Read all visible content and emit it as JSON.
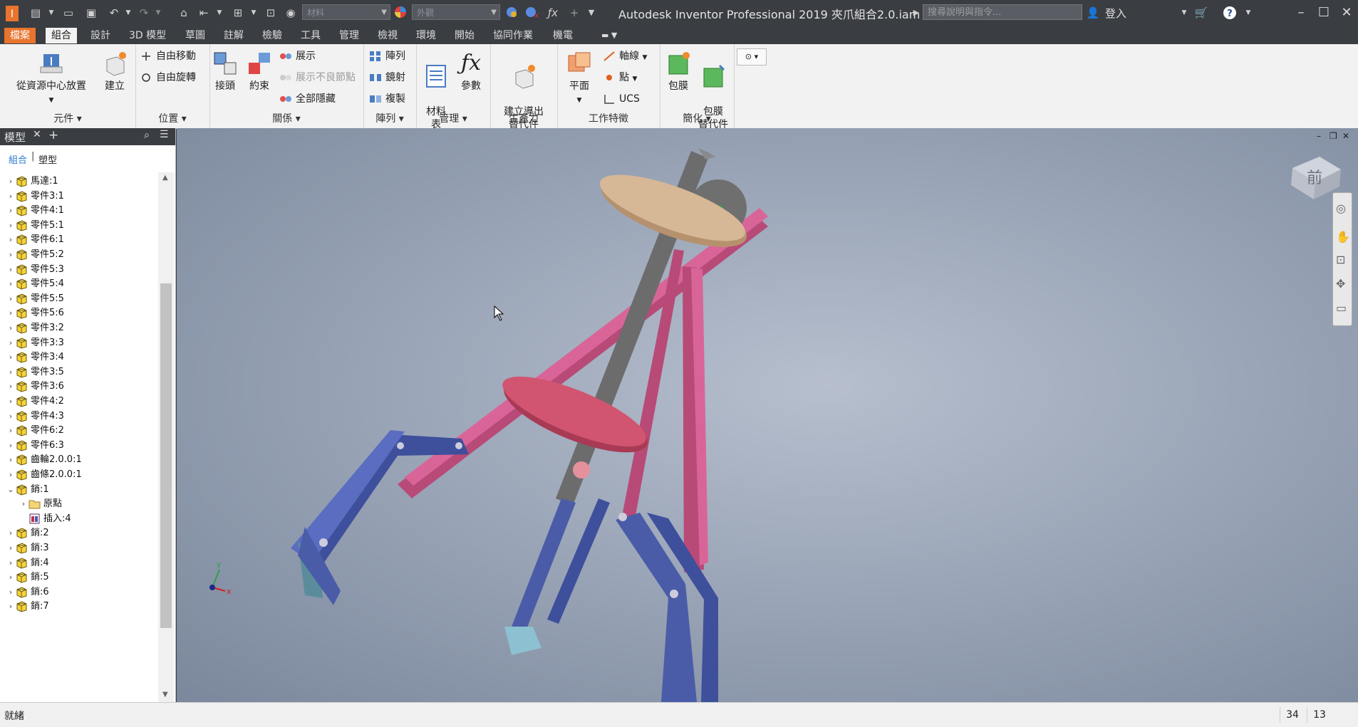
{
  "titlebar": {
    "app_title": "Autodesk Inventor Professional 2019    夾爪組合2.0.iam",
    "material_combo": "材料",
    "appearance_combo": "外觀",
    "search_placeholder": "搜尋說明與指令...",
    "signin": "登入"
  },
  "tabs": [
    "檔案",
    "組合",
    "設計",
    "3D 模型",
    "草圖",
    "註解",
    "檢驗",
    "工具",
    "管理",
    "檢視",
    "環境",
    "開始",
    "協同作業",
    "機電"
  ],
  "ribbon": {
    "component": {
      "place_from_cc": "從資源中心放置",
      "create": "建立",
      "title": "元件"
    },
    "position": {
      "free_move": "自由移動",
      "free_rotate": "自由旋轉",
      "title": "位置"
    },
    "relations": {
      "joint": "接頭",
      "constrain": "約束",
      "show": "展示",
      "show_sick": "展示不良節點",
      "hide_all": "全部隱藏",
      "title": "關係"
    },
    "pattern": {
      "pattern": "陣列",
      "mirror": "鏡射",
      "copy": "複製",
      "title": "陣列"
    },
    "manage": {
      "bom": "材料\n表",
      "params": "參數",
      "title": "管理"
    },
    "productivity": {
      "create_derived": "建立導出\n替代件",
      "title": "生產力"
    },
    "work_features": {
      "plane": "平面",
      "axis": "軸線",
      "point": "點",
      "ucs": "UCS",
      "title": "工作特徵"
    },
    "simplification": {
      "shrinkwrap": "包膜",
      "shrinkwrap_sub": "包膜\n替代件",
      "title": "簡化"
    }
  },
  "browser": {
    "tab": "模型",
    "mode_assembly": "組合",
    "mode_modeling": "塑型",
    "items": [
      {
        "label": "馬達:1",
        "icon": "part-icon",
        "indent": 0,
        "expand": "collapsed"
      },
      {
        "label": "零件3:1",
        "icon": "part-icon",
        "indent": 0,
        "expand": "collapsed"
      },
      {
        "label": "零件4:1",
        "icon": "part-icon",
        "indent": 0,
        "expand": "collapsed"
      },
      {
        "label": "零件5:1",
        "icon": "part-icon",
        "indent": 0,
        "expand": "collapsed"
      },
      {
        "label": "零件6:1",
        "icon": "part-icon",
        "indent": 0,
        "expand": "collapsed"
      },
      {
        "label": "零件5:2",
        "icon": "part-icon",
        "indent": 0,
        "expand": "collapsed"
      },
      {
        "label": "零件5:3",
        "icon": "part-icon",
        "indent": 0,
        "expand": "collapsed"
      },
      {
        "label": "零件5:4",
        "icon": "part-icon",
        "indent": 0,
        "expand": "collapsed"
      },
      {
        "label": "零件5:5",
        "icon": "part-icon",
        "indent": 0,
        "expand": "collapsed"
      },
      {
        "label": "零件5:6",
        "icon": "part-icon",
        "indent": 0,
        "expand": "collapsed"
      },
      {
        "label": "零件3:2",
        "icon": "part-icon",
        "indent": 0,
        "expand": "collapsed"
      },
      {
        "label": "零件3:3",
        "icon": "part-icon",
        "indent": 0,
        "expand": "collapsed"
      },
      {
        "label": "零件3:4",
        "icon": "part-icon",
        "indent": 0,
        "expand": "collapsed"
      },
      {
        "label": "零件3:5",
        "icon": "part-icon",
        "indent": 0,
        "expand": "collapsed"
      },
      {
        "label": "零件3:6",
        "icon": "part-icon",
        "indent": 0,
        "expand": "collapsed"
      },
      {
        "label": "零件4:2",
        "icon": "part-icon",
        "indent": 0,
        "expand": "collapsed"
      },
      {
        "label": "零件4:3",
        "icon": "part-icon",
        "indent": 0,
        "expand": "collapsed"
      },
      {
        "label": "零件6:2",
        "icon": "part-icon",
        "indent": 0,
        "expand": "collapsed"
      },
      {
        "label": "零件6:3",
        "icon": "part-icon",
        "indent": 0,
        "expand": "collapsed"
      },
      {
        "label": "齒輪2.0.0:1",
        "icon": "part-icon",
        "indent": 0,
        "expand": "collapsed"
      },
      {
        "label": "齒條2.0.0:1",
        "icon": "part-icon",
        "indent": 0,
        "expand": "collapsed"
      },
      {
        "label": "銷:1",
        "icon": "part-icon",
        "indent": 0,
        "expand": "expanded"
      },
      {
        "label": "原點",
        "icon": "folder-icon",
        "indent": 1,
        "expand": "collapsed"
      },
      {
        "label": "插入:4",
        "icon": "insert-constraint-icon",
        "indent": 1,
        "expand": "none"
      },
      {
        "label": "銷:2",
        "icon": "part-icon",
        "indent": 0,
        "expand": "collapsed"
      },
      {
        "label": "銷:3",
        "icon": "part-icon",
        "indent": 0,
        "expand": "collapsed"
      },
      {
        "label": "銷:4",
        "icon": "part-icon",
        "indent": 0,
        "expand": "collapsed"
      },
      {
        "label": "銷:5",
        "icon": "part-icon",
        "indent": 0,
        "expand": "collapsed"
      },
      {
        "label": "銷:6",
        "icon": "part-icon",
        "indent": 0,
        "expand": "collapsed"
      },
      {
        "label": "銷:7",
        "icon": "part-icon",
        "indent": 0,
        "expand": "collapsed"
      }
    ]
  },
  "viewcube": {
    "face": "前"
  },
  "status": {
    "text": "就緒",
    "count1": "34",
    "count2": "13"
  },
  "colors": {
    "accent": "#e8742d",
    "blue_part": "#4a5fae",
    "pink_part": "#c4507f",
    "tan_disc": "#c9a98a",
    "gray_rack": "#6e6e6e"
  }
}
